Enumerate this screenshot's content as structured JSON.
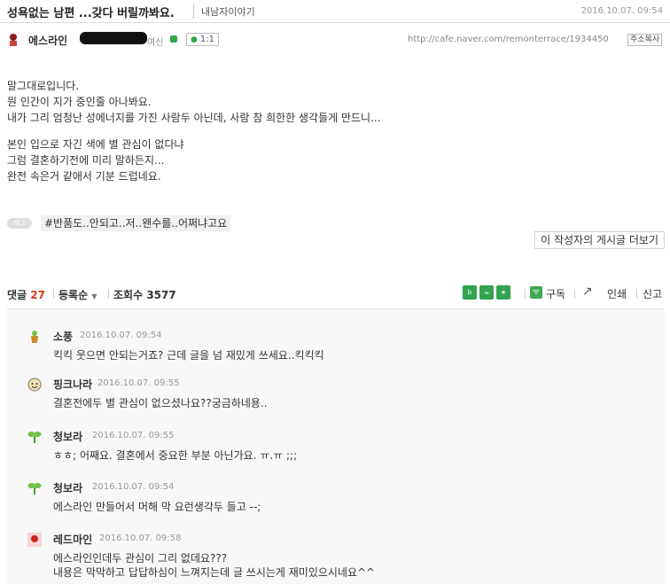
{
  "post": {
    "title": "성욕없는 남편 ...갖다 버릴까봐요.",
    "board": "내남자이야기",
    "date": "2016.10.07. 09:54",
    "author": "에스라인",
    "level": "여신",
    "chat_count": "1:1",
    "url": "http://cafe.naver.com/remonterrace/1934450",
    "copy_label": "주소복사",
    "body": [
      "말그대로입니다.",
      "뭔 인간이 지가 중인줄 아나봐요.",
      "내가 그리 엄청난 성에너지를 가진 사람두 아닌데, 사람 참 희한한 생각들게 만드니...",
      "",
      "본인 입으로 자긴 색에 별 관심이 없다냐",
      "그럼 결혼하기전에 미리 말하든지...",
      "완전 속은거 같애서 기분 드럽네요."
    ],
    "tag_label": "태그",
    "tag": "#반품도..안되고..저..왠수를..어쩌냐고요",
    "more_label": "이 작성자의 게시글 더보기"
  },
  "comment_bar": {
    "label": "댓글",
    "count": "27",
    "sort_label": "등록순",
    "view_label": "조회수",
    "view_count": "3577",
    "subscribe_label": "구독",
    "print_label": "인쇄",
    "share_label": "신고",
    "share_icons": [
      "blog-icon",
      "cafe-icon",
      "bookmark-icon"
    ]
  },
  "comments": [
    {
      "name": "소풍",
      "date": "2016.10.07. 09:54",
      "text": [
        "킥킥 웃으면 안되는거죠? 근데 글을 넘 재밌게 쓰세요..킥킥킥"
      ],
      "avatar": "flower-pot-icon"
    },
    {
      "name": "핑크나라",
      "date": "2016.10.07. 09:55",
      "text": [
        "결혼전에두 별 관심이 없으셨나요??궁금하네용.."
      ],
      "avatar": "smiley-face-icon"
    },
    {
      "name": "청보라",
      "date": "2016.10.07. 09:55",
      "text": [
        "ㅎㅎ; 어째요. 결혼에서 중요한 부분 아닌가요. ㅠ.ㅠ ;;;"
      ],
      "avatar": "sprout-icon"
    },
    {
      "name": "청보라",
      "date": "2016.10.07. 09:54",
      "text": [
        "에스라인 만들어서 머해 막 요런생각두 들고 --;"
      ],
      "avatar": "sprout-icon"
    },
    {
      "name": "레드마인",
      "date": "2016.10.07. 09:58",
      "text": [
        "에스라인인데두 관심이 그리 없데요???",
        "내용은 막막하고 답답하심이 느껴지는데 글 쓰시는게 재미있으시네요^^"
      ],
      "avatar": "red-avatar-icon"
    }
  ],
  "colors": {
    "comment_count": "#d83a1c",
    "share_green": "#33a352",
    "comment_bg": "#f8f8f8"
  }
}
